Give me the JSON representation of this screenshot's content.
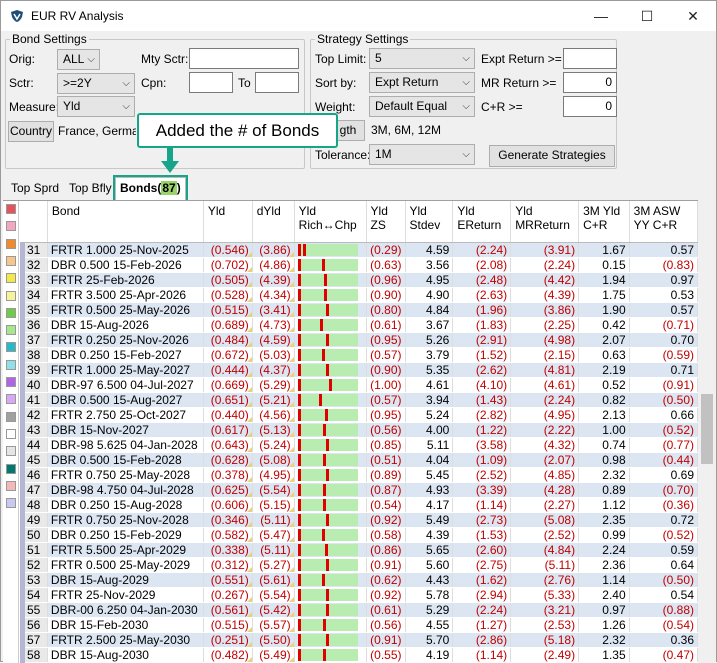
{
  "window": {
    "title": "EUR RV Analysis",
    "min_label": "—",
    "max_label": "☐",
    "close_label": "✕"
  },
  "bond_settings": {
    "legend": "Bond Settings",
    "orig_label": "Orig:",
    "orig_value": "ALL",
    "mty_label": "Mty Sctr:",
    "mty_value": "",
    "sctr_label": "Sctr:",
    "sctr_value": ">=2Y",
    "cpn_label": "Cpn:",
    "cpn_value": "",
    "to_label": "To",
    "to_value": "",
    "measure_label": "Measure:",
    "measure_value": "Yld",
    "country_button": "Country",
    "country_value": "France, German"
  },
  "strategy_settings": {
    "legend": "Strategy Settings",
    "top_limit_label": "Top Limit:",
    "top_limit_value": "5",
    "sort_by_label": "Sort by:",
    "sort_by_value": "Expt Return",
    "weight_label": "Weight:",
    "weight_value": "Default Equal",
    "tolerance_label": "Tolerance:",
    "tolerance_value": "1M",
    "expt_return_label": "Expt Return >=",
    "expt_return_value": "",
    "mr_return_label": "MR Return >=",
    "mr_return_value": "0",
    "cr_label": "C+R >=",
    "cr_value": "0",
    "horizon_button": "gth",
    "horizon_value": "3M, 6M, 12M",
    "generate_button": "Generate Strategies"
  },
  "callout": "Added the # of Bonds",
  "tabs": {
    "top_sprd": "Top Sprd",
    "top_bfly": "Top Bfly",
    "bonds": "Bonds(",
    "bonds_count": "87",
    "bonds_close": ")"
  },
  "swatch_colors": [
    "#e8525c",
    "#f4a7c3",
    "#f08a2c",
    "#f7c68a",
    "#f2e84a",
    "#f6f39a",
    "#6ecc4a",
    "#a7e68f",
    "#29b8c8",
    "#8fe0e8",
    "#b064e8",
    "#d8a8f4",
    "#a0a0a0",
    "#ffffff",
    "#e5e5e5",
    "#007a6e",
    "#f4b8b8",
    "#c8c8f0"
  ],
  "columns": [
    "",
    "Bond",
    "Yld",
    "dYld",
    "Yld\nRich↔Chp",
    "Yld\nZS",
    "Yld\nStdev",
    "Yld\nEReturn",
    "Yld\nMRReturn",
    "3M Yld\nC+R",
    "3M ASW\nYY C+R"
  ],
  "rows": [
    {
      "n": "31",
      "bond": "FRTR 1.000 25-Nov-2025",
      "yld": "(0.546)",
      "dyld": "(3.86)",
      "rich": 0.1,
      "zs": "(0.29)",
      "stdev": "4.59",
      "eret": "(2.24)",
      "mret": "(3.91)",
      "cr": "1.67",
      "asw": "0.57"
    },
    {
      "n": "32",
      "bond": "DBR 0.500 15-Feb-2026",
      "yld": "(0.702)",
      "dyld": "(4.86)",
      "rich": 0.43,
      "zs": "(0.63)",
      "stdev": "3.56",
      "eret": "(2.08)",
      "mret": "(2.24)",
      "cr": "0.15",
      "asw": "(0.83)"
    },
    {
      "n": "33",
      "bond": "FRTR 25-Feb-2026",
      "yld": "(0.505)",
      "dyld": "(4.39)",
      "rich": 0.47,
      "zs": "(0.96)",
      "stdev": "4.95",
      "eret": "(2.48)",
      "mret": "(4.42)",
      "cr": "1.94",
      "asw": "0.97"
    },
    {
      "n": "34",
      "bond": "FRTR 3.500 25-Apr-2026",
      "yld": "(0.528)",
      "dyld": "(4.34)",
      "rich": 0.47,
      "zs": "(0.90)",
      "stdev": "4.90",
      "eret": "(2.63)",
      "mret": "(4.39)",
      "cr": "1.75",
      "asw": "0.53"
    },
    {
      "n": "35",
      "bond": "FRTR 0.500 25-May-2026",
      "yld": "(0.515)",
      "dyld": "(3.41)",
      "rich": 0.5,
      "zs": "(0.80)",
      "stdev": "4.84",
      "eret": "(1.96)",
      "mret": "(3.86)",
      "cr": "1.90",
      "asw": "0.57"
    },
    {
      "n": "36",
      "bond": "DBR 15-Aug-2026",
      "yld": "(0.689)",
      "dyld": "(4.73)",
      "rich": 0.4,
      "zs": "(0.61)",
      "stdev": "3.67",
      "eret": "(1.83)",
      "mret": "(2.25)",
      "cr": "0.42",
      "asw": "(0.71)"
    },
    {
      "n": "37",
      "bond": "FRTR 0.250 25-Nov-2026",
      "yld": "(0.484)",
      "dyld": "(4.59)",
      "rich": 0.5,
      "zs": "(0.95)",
      "stdev": "5.26",
      "eret": "(2.91)",
      "mret": "(4.98)",
      "cr": "2.07",
      "asw": "0.70"
    },
    {
      "n": "38",
      "bond": "DBR 0.250 15-Feb-2027",
      "yld": "(0.672)",
      "dyld": "(5.03)",
      "rich": 0.43,
      "zs": "(0.57)",
      "stdev": "3.79",
      "eret": "(1.52)",
      "mret": "(2.15)",
      "cr": "0.63",
      "asw": "(0.59)"
    },
    {
      "n": "39",
      "bond": "FRTR 1.000 25-May-2027",
      "yld": "(0.444)",
      "dyld": "(4.37)",
      "rich": 0.5,
      "zs": "(0.90)",
      "stdev": "5.35",
      "eret": "(2.62)",
      "mret": "(4.81)",
      "cr": "2.19",
      "asw": "0.71"
    },
    {
      "n": "40",
      "bond": "DBR-97 6.500 04-Jul-2027",
      "yld": "(0.669)",
      "dyld": "(5.29)",
      "rich": 0.55,
      "zs": "(1.00)",
      "stdev": "4.61",
      "eret": "(4.10)",
      "mret": "(4.61)",
      "cr": "0.52",
      "asw": "(0.91)"
    },
    {
      "n": "41",
      "bond": "DBR 0.500 15-Aug-2027",
      "yld": "(0.651)",
      "dyld": "(5.21)",
      "rich": 0.38,
      "zs": "(0.57)",
      "stdev": "3.94",
      "eret": "(1.43)",
      "mret": "(2.24)",
      "cr": "0.82",
      "asw": "(0.50)"
    },
    {
      "n": "42",
      "bond": "FRTR 2.750 25-Oct-2027",
      "yld": "(0.440)",
      "dyld": "(4.56)",
      "rich": 0.48,
      "zs": "(0.95)",
      "stdev": "5.24",
      "eret": "(2.82)",
      "mret": "(4.95)",
      "cr": "2.13",
      "asw": "0.66"
    },
    {
      "n": "43",
      "bond": "DBR 15-Nov-2027",
      "yld": "(0.617)",
      "dyld": "(5.13)",
      "rich": 0.45,
      "zs": "(0.56)",
      "stdev": "4.00",
      "eret": "(1.22)",
      "mret": "(2.22)",
      "cr": "1.00",
      "asw": "(0.52)"
    },
    {
      "n": "44",
      "bond": "DBR-98 5.625 04-Jan-2028",
      "yld": "(0.643)",
      "dyld": "(5.24)",
      "rich": 0.5,
      "zs": "(0.85)",
      "stdev": "5.11",
      "eret": "(3.58)",
      "mret": "(4.32)",
      "cr": "0.74",
      "asw": "(0.77)"
    },
    {
      "n": "45",
      "bond": "DBR 0.500 15-Feb-2028",
      "yld": "(0.628)",
      "dyld": "(5.08)",
      "rich": 0.45,
      "zs": "(0.51)",
      "stdev": "4.04",
      "eret": "(1.09)",
      "mret": "(2.07)",
      "cr": "0.98",
      "asw": "(0.44)"
    },
    {
      "n": "46",
      "bond": "FRTR 0.750 25-May-2028",
      "yld": "(0.378)",
      "dyld": "(4.95)",
      "rich": 0.5,
      "zs": "(0.89)",
      "stdev": "5.45",
      "eret": "(2.52)",
      "mret": "(4.85)",
      "cr": "2.32",
      "asw": "0.69"
    },
    {
      "n": "47",
      "bond": "DBR-98 4.750 04-Jul-2028",
      "yld": "(0.625)",
      "dyld": "(5.54)",
      "rich": 0.45,
      "zs": "(0.87)",
      "stdev": "4.93",
      "eret": "(3.39)",
      "mret": "(4.28)",
      "cr": "0.89",
      "asw": "(0.70)"
    },
    {
      "n": "48",
      "bond": "DBR 0.250 15-Aug-2028",
      "yld": "(0.606)",
      "dyld": "(5.15)",
      "rich": 0.45,
      "zs": "(0.54)",
      "stdev": "4.17",
      "eret": "(1.14)",
      "mret": "(2.27)",
      "cr": "1.12",
      "asw": "(0.36)"
    },
    {
      "n": "49",
      "bond": "FRTR 0.750 25-Nov-2028",
      "yld": "(0.346)",
      "dyld": "(5.11)",
      "rich": 0.5,
      "zs": "(0.92)",
      "stdev": "5.49",
      "eret": "(2.73)",
      "mret": "(5.08)",
      "cr": "2.35",
      "asw": "0.72"
    },
    {
      "n": "50",
      "bond": "DBR 0.250 15-Feb-2029",
      "yld": "(0.582)",
      "dyld": "(5.47)",
      "rich": 0.43,
      "zs": "(0.58)",
      "stdev": "4.39",
      "eret": "(1.53)",
      "mret": "(2.52)",
      "cr": "0.99",
      "asw": "(0.52)"
    },
    {
      "n": "51",
      "bond": "FRTR 5.500 25-Apr-2029",
      "yld": "(0.338)",
      "dyld": "(5.11)",
      "rich": 0.48,
      "zs": "(0.86)",
      "stdev": "5.65",
      "eret": "(2.60)",
      "mret": "(4.84)",
      "cr": "2.24",
      "asw": "0.59"
    },
    {
      "n": "52",
      "bond": "FRTR 0.500 25-May-2029",
      "yld": "(0.312)",
      "dyld": "(5.27)",
      "rich": 0.5,
      "zs": "(0.91)",
      "stdev": "5.60",
      "eret": "(2.75)",
      "mret": "(5.11)",
      "cr": "2.36",
      "asw": "0.64"
    },
    {
      "n": "53",
      "bond": "DBR 15-Aug-2029",
      "yld": "(0.551)",
      "dyld": "(5.61)",
      "rich": 0.43,
      "zs": "(0.62)",
      "stdev": "4.43",
      "eret": "(1.62)",
      "mret": "(2.76)",
      "cr": "1.14",
      "asw": "(0.50)"
    },
    {
      "n": "54",
      "bond": "FRTR 25-Nov-2029",
      "yld": "(0.267)",
      "dyld": "(5.54)",
      "rich": 0.5,
      "zs": "(0.92)",
      "stdev": "5.78",
      "eret": "(2.94)",
      "mret": "(5.33)",
      "cr": "2.40",
      "asw": "0.54"
    },
    {
      "n": "55",
      "bond": "DBR-00 6.250 04-Jan-2030",
      "yld": "(0.561)",
      "dyld": "(5.42)",
      "rich": 0.5,
      "zs": "(0.61)",
      "stdev": "5.29",
      "eret": "(2.24)",
      "mret": "(3.21)",
      "cr": "0.97",
      "asw": "(0.88)"
    },
    {
      "n": "56",
      "bond": "DBR 15-Feb-2030",
      "yld": "(0.515)",
      "dyld": "(5.57)",
      "rich": 0.45,
      "zs": "(0.56)",
      "stdev": "4.55",
      "eret": "(1.27)",
      "mret": "(2.53)",
      "cr": "1.26",
      "asw": "(0.54)"
    },
    {
      "n": "57",
      "bond": "FRTR 2.500 25-May-2030",
      "yld": "(0.251)",
      "dyld": "(5.50)",
      "rich": 0.5,
      "zs": "(0.91)",
      "stdev": "5.70",
      "eret": "(2.86)",
      "mret": "(5.18)",
      "cr": "2.32",
      "asw": "0.36"
    },
    {
      "n": "58",
      "bond": "DBR 15-Aug-2030",
      "yld": "(0.482)",
      "dyld": "(5.49)",
      "rich": 0.45,
      "zs": "(0.55)",
      "stdev": "4.19",
      "eret": "(1.14)",
      "mret": "(2.49)",
      "cr": "1.35",
      "asw": "(0.47)"
    }
  ]
}
